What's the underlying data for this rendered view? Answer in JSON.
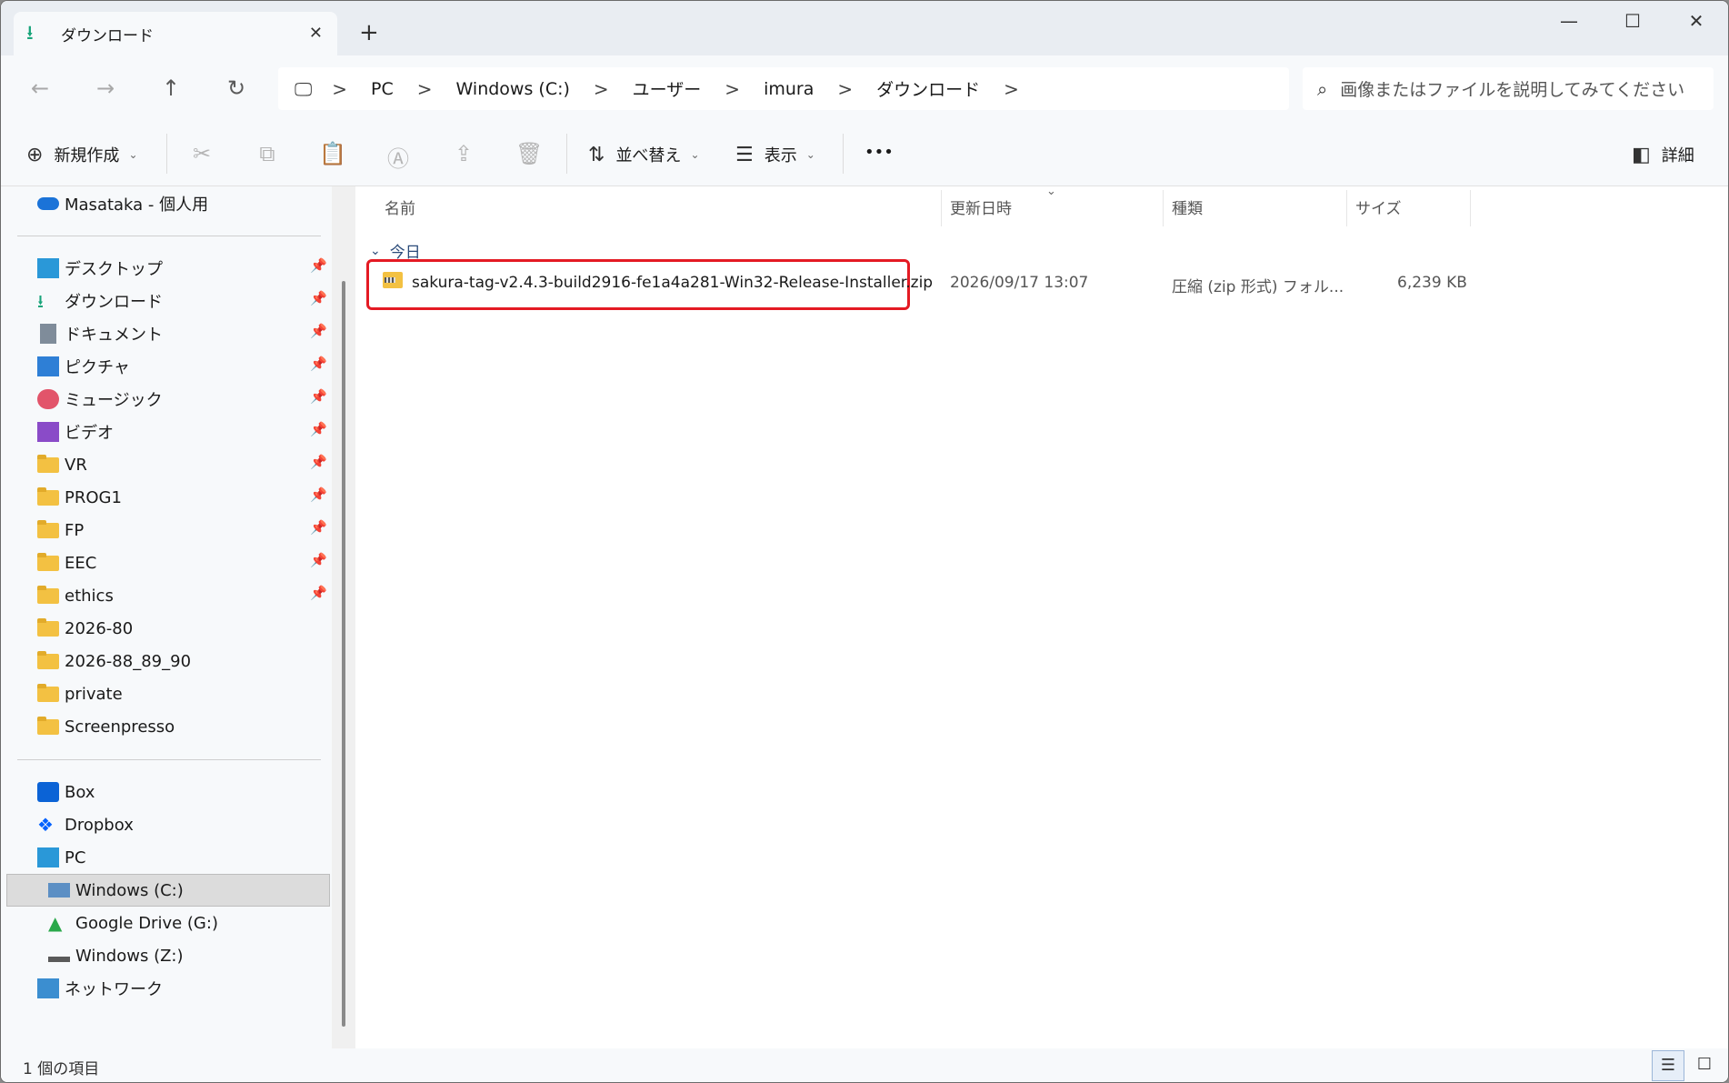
{
  "titlebar": {
    "tab_title": "ダウンロード",
    "close_tab": "✕",
    "new_tab": "+",
    "minimize": "—",
    "maximize": "☐",
    "close_window": "✕"
  },
  "address_bar": {
    "crumbs": [
      "PC",
      "Windows (C:)",
      "ユーザー",
      "imura",
      "ダウンロード"
    ],
    "separator": ">"
  },
  "search": {
    "placeholder": "画像またはファイルを説明してみてください"
  },
  "toolbar": {
    "new_label": "新規作成",
    "sort_label": "並べ替え",
    "view_label": "表示",
    "more_label": "•••",
    "details_label": "詳細"
  },
  "sidebar": {
    "account": "Masataka - 個人用",
    "quick_access": [
      {
        "label": "デスクトップ",
        "icon": "desktop-icon",
        "pinned": true
      },
      {
        "label": "ダウンロード",
        "icon": "download-icon",
        "pinned": true
      },
      {
        "label": "ドキュメント",
        "icon": "document-icon",
        "pinned": true
      },
      {
        "label": "ピクチャ",
        "icon": "pictures-icon",
        "pinned": true
      },
      {
        "label": "ミュージック",
        "icon": "music-icon",
        "pinned": true
      },
      {
        "label": "ビデオ",
        "icon": "video-icon",
        "pinned": true
      },
      {
        "label": "VR",
        "icon": "folder-icon",
        "pinned": true
      },
      {
        "label": "PROG1",
        "icon": "folder-icon",
        "pinned": true
      },
      {
        "label": "FP",
        "icon": "folder-icon",
        "pinned": true
      },
      {
        "label": "EEC",
        "icon": "folder-icon",
        "pinned": true
      },
      {
        "label": "ethics",
        "icon": "folder-icon",
        "pinned": true
      },
      {
        "label": "2026-80",
        "icon": "folder-icon",
        "pinned": false
      },
      {
        "label": "2026-88_89_90",
        "icon": "folder-icon",
        "pinned": false
      },
      {
        "label": "private",
        "icon": "folder-icon",
        "pinned": false
      },
      {
        "label": "Screenpresso",
        "icon": "folder-icon",
        "pinned": false
      }
    ],
    "locations": [
      {
        "label": "Box",
        "icon": "box-icon"
      },
      {
        "label": "Dropbox",
        "icon": "dropbox-icon"
      },
      {
        "label": "PC",
        "icon": "pc-icon"
      },
      {
        "label": "Windows (C:)",
        "icon": "drive-icon"
      },
      {
        "label": "Google Drive (G:)",
        "icon": "google-drive-icon"
      },
      {
        "label": "Windows (Z:)",
        "icon": "network-drive-icon"
      },
      {
        "label": "ネットワーク",
        "icon": "network-icon"
      }
    ],
    "pin_glyph": "📌"
  },
  "content": {
    "columns": {
      "name": "名前",
      "modified": "更新日時",
      "type": "種類",
      "size": "サイズ"
    },
    "group_label": "今日",
    "files": [
      {
        "name": "sakura-tag-v2.4.3-build2916-fe1a4a281-Win32-Release-Installer.zip",
        "modified": "2026/09/17 13:07",
        "type": "圧縮 (zip 形式) フォル...",
        "size": "6,239 KB"
      }
    ]
  },
  "status": {
    "item_count": "1 個の項目"
  },
  "colors": {
    "highlight": "#e41a23",
    "folder": "#f3c142",
    "accent": "#18a47a"
  }
}
